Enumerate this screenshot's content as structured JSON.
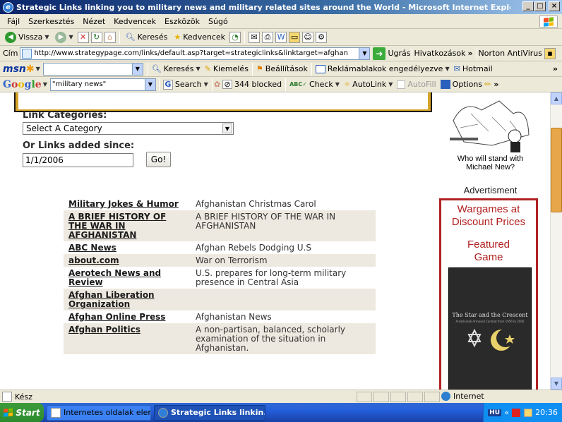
{
  "window": {
    "title": "Strategic Links linking you to military news and military related sites around the World - Microsoft Internet Explorer"
  },
  "menu": [
    "Fájl",
    "Szerkesztés",
    "Nézet",
    "Kedvencek",
    "Eszközök",
    "Súgó"
  ],
  "toolbar": {
    "back": "Vissza",
    "search": "Keresés",
    "favorites": "Kedvencek"
  },
  "address": {
    "label": "Cím",
    "url": "http://www.strategypage.com/links/default.asp?target=strategiclinks&linktarget=afghan",
    "go": "Ugrás",
    "links": "Hivatkozások",
    "norton": "Norton AntiVirus"
  },
  "msn": {
    "search": "Keresés",
    "highlight": "Kiemelés",
    "settings": "Beállítások",
    "popup": "Reklámablakok engedélyezve",
    "hotmail": "Hotmail"
  },
  "google": {
    "query": "\"military news\"",
    "search": "Search",
    "blocked": "344 blocked",
    "check": "Check",
    "autolink": "AutoLink",
    "autofill": "AutoFill",
    "options": "Options"
  },
  "form": {
    "categories_label": "Link Categories:",
    "category_selected": "Select A Category",
    "since_label": "Or Links added since:",
    "since_value": "1/1/2006",
    "go": "Go!"
  },
  "links": [
    {
      "name": "Military Jokes & Humor",
      "desc": "Afghanistan Christmas Carol"
    },
    {
      "name": "A BRIEF HISTORY OF THE WAR IN AFGHANISTAN",
      "desc": "A BRIEF HISTORY OF THE WAR IN AFGHANISTAN"
    },
    {
      "name": "ABC News",
      "desc": "Afghan Rebels Dodging U.S"
    },
    {
      "name": "about.com",
      "desc": "War on Terrorism"
    },
    {
      "name": "Aerotech News and Review",
      "desc": "U.S. prepares for long-term military presence in Central Asia"
    },
    {
      "name": "Afghan Liberation Organization",
      "desc": ""
    },
    {
      "name": "Afghan Online Press",
      "desc": "Afghanistan News"
    },
    {
      "name": "Afghan Politics",
      "desc": "A non-partisan, balanced, scholarly examination of the situation in Afghanistan."
    }
  ],
  "sidebar": {
    "cartoon_caption": "Who will stand with Michael New?",
    "advertisment": "Advertisment",
    "ad_line1": "Wargames at Discount Prices",
    "ad_line2": "Featured Game",
    "book_title": "The Star and the Crescent",
    "book_subtitle": "Arab/Israeli Armored Combat from 1956 to 2000"
  },
  "status": {
    "text": "Kész",
    "zone": "Internet"
  },
  "taskbar": {
    "start": "Start",
    "task1": "Internetes oldalak elemz...",
    "task2": "Strategic Links linkin...",
    "lang": "HU",
    "time": "20:36"
  }
}
